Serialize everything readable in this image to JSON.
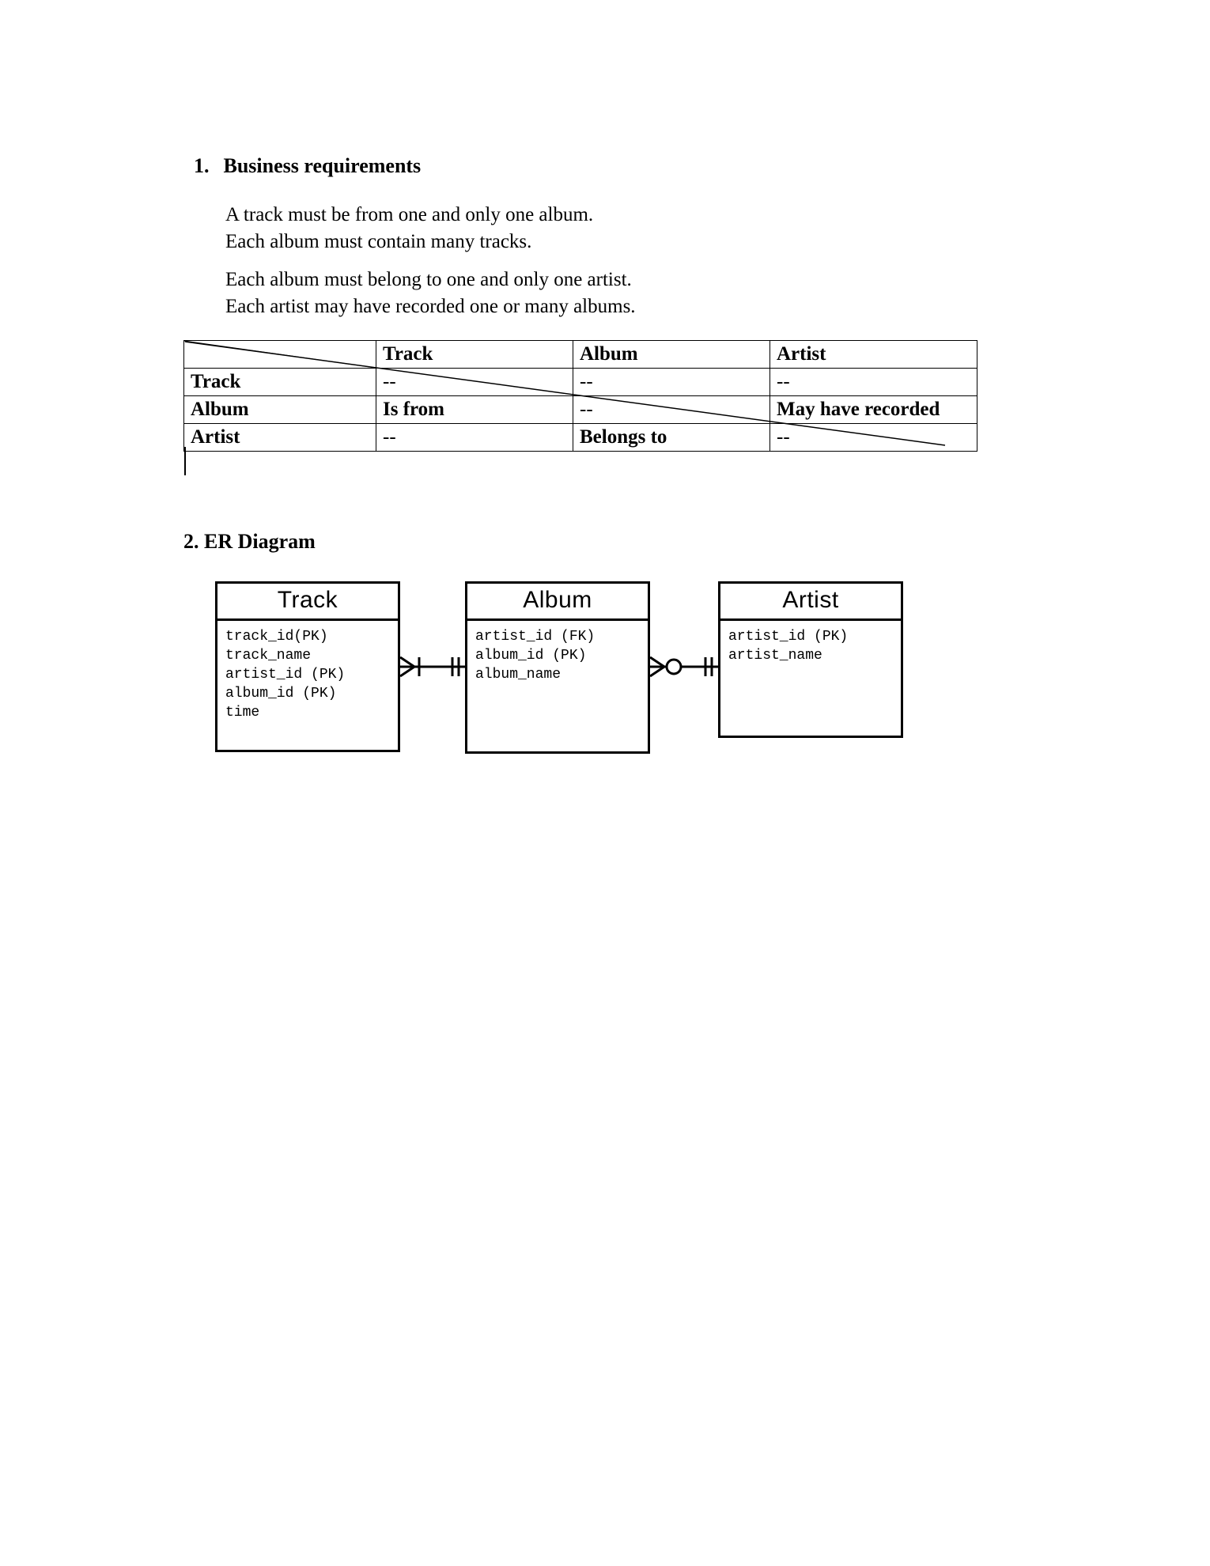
{
  "sections": {
    "s1": {
      "marker": "1.",
      "title": "Business requirements"
    },
    "s2": {
      "title": "2. ER Diagram"
    }
  },
  "requirements": {
    "p1_l1": "A track must be from one and only one album.",
    "p1_l2": "Each album must contain many tracks.",
    "p2_l1": "Each album must belong to one and only one artist.",
    "p2_l2": "Each artist may have recorded one or many albums."
  },
  "matrix": {
    "col_headers": [
      "",
      "Track",
      "Album",
      "Artist"
    ],
    "rows": [
      {
        "head": "Track",
        "cells": [
          "--",
          "--",
          "--"
        ]
      },
      {
        "head": "Album",
        "cells": [
          "Is from",
          "--",
          "May have recorded"
        ]
      },
      {
        "head": "Artist",
        "cells": [
          "--",
          "Belongs to",
          "--"
        ]
      }
    ]
  },
  "er": {
    "entities": {
      "track": {
        "title": "Track",
        "attrs": [
          "track_id(PK)",
          "track_name",
          "artist_id (PK)",
          "album_id (PK)",
          "time"
        ]
      },
      "album": {
        "title": "Album",
        "attrs": [
          "artist_id (FK)",
          "album_id (PK)",
          "album_name"
        ]
      },
      "artist": {
        "title": "Artist",
        "attrs": [
          "artist_id (PK)",
          "artist_name"
        ]
      }
    },
    "relationships": [
      {
        "from": "track",
        "to": "album",
        "from_card": "many-mandatory",
        "to_card": "one-mandatory"
      },
      {
        "from": "album",
        "to": "artist",
        "from_card": "many-optional",
        "to_card": "one-mandatory"
      }
    ]
  }
}
